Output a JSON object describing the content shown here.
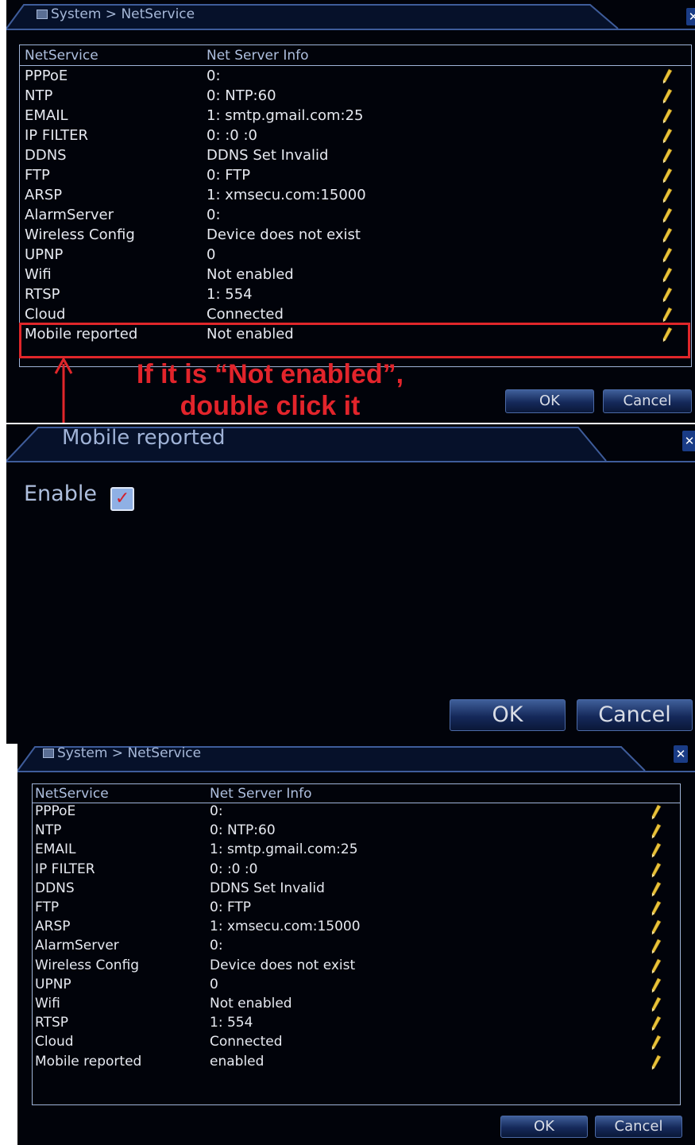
{
  "panel1": {
    "breadcrumb": "System > NetService",
    "columns": [
      "NetService",
      "Net Server Info"
    ],
    "rows": [
      {
        "name": "PPPoE",
        "info": "0:"
      },
      {
        "name": "NTP",
        "info": "0: NTP:60"
      },
      {
        "name": "EMAIL",
        "info": "1: smtp.gmail.com:25"
      },
      {
        "name": "IP FILTER",
        "info": "0: :0 :0"
      },
      {
        "name": "DDNS",
        "info": "DDNS Set Invalid"
      },
      {
        "name": "FTP",
        "info": "0: FTP"
      },
      {
        "name": "ARSP",
        "info": "1: xmsecu.com:15000"
      },
      {
        "name": "AlarmServer",
        "info": "0:"
      },
      {
        "name": "Wireless Config",
        "info": "Device does not exist"
      },
      {
        "name": "UPNP",
        "info": "0"
      },
      {
        "name": "Wifi",
        "info": "Not enabled"
      },
      {
        "name": "RTSP",
        "info": "1: 554"
      },
      {
        "name": "Cloud",
        "info": "Connected"
      },
      {
        "name": "Mobile reported",
        "info": "Not enabled"
      }
    ],
    "ok_label": "OK",
    "cancel_label": "Cancel"
  },
  "annotation": {
    "line1": "If it is “Not enabled”,",
    "line2": "double click it"
  },
  "dialog": {
    "title": "Mobile reported",
    "enable_label": "Enable",
    "enable_checked": true,
    "ok_label": "OK",
    "cancel_label": "Cancel"
  },
  "panel3": {
    "breadcrumb": "System > NetService",
    "columns": [
      "NetService",
      "Net Server Info"
    ],
    "rows": [
      {
        "name": "PPPoE",
        "info": "0:"
      },
      {
        "name": "NTP",
        "info": "0: NTP:60"
      },
      {
        "name": "EMAIL",
        "info": "1: smtp.gmail.com:25"
      },
      {
        "name": "IP FILTER",
        "info": "0: :0 :0"
      },
      {
        "name": "DDNS",
        "info": "DDNS Set Invalid"
      },
      {
        "name": "FTP",
        "info": "0: FTP"
      },
      {
        "name": "ARSP",
        "info": "1: xmsecu.com:15000"
      },
      {
        "name": "AlarmServer",
        "info": "0:"
      },
      {
        "name": "Wireless Config",
        "info": "Device does not exist"
      },
      {
        "name": "UPNP",
        "info": "0"
      },
      {
        "name": "Wifi",
        "info": "Not enabled"
      },
      {
        "name": "RTSP",
        "info": "1: 554"
      },
      {
        "name": "Cloud",
        "info": "Connected"
      },
      {
        "name": "Mobile reported",
        "info": "enabled"
      }
    ],
    "ok_label": "OK",
    "cancel_label": "Cancel"
  },
  "colors": {
    "panel_bg": "#01030a",
    "border_blue": "#9fb4d8",
    "title_blue": "#a6b8d8",
    "highlight_red": "#e0262a",
    "pencil_yellow": "#e8c23a"
  },
  "icons": [
    "monitor-icon",
    "close-icon",
    "edit-pencil-icon",
    "checkbox-checked-icon",
    "up-arrow-icon"
  ]
}
